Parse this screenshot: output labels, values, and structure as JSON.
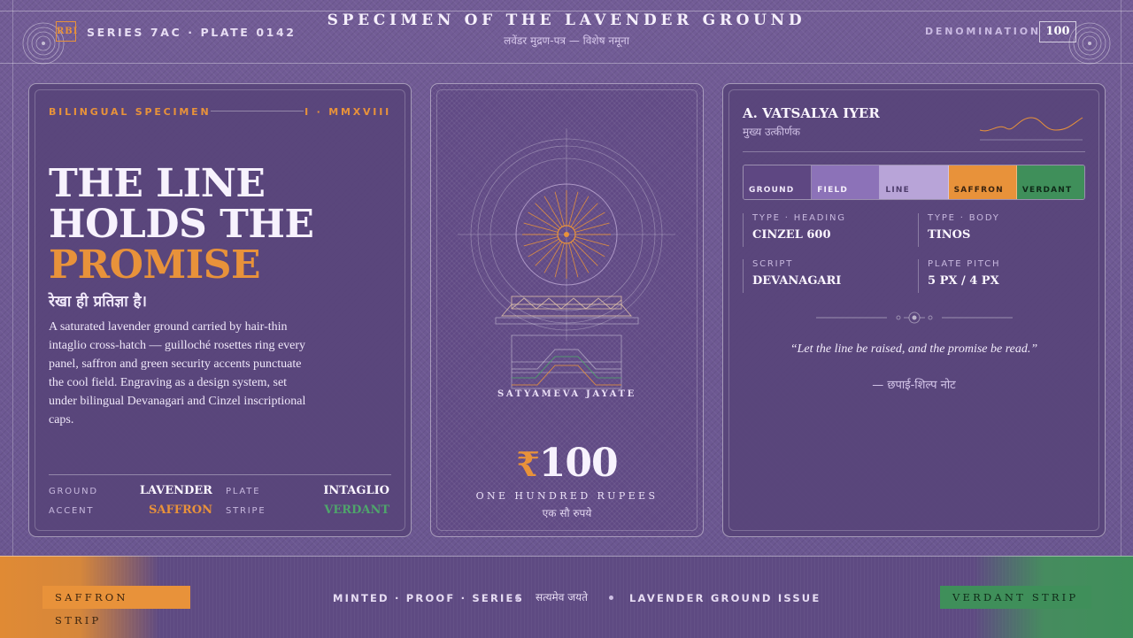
{
  "colors": {
    "ground": "#5e4782",
    "field": "#8c72b8",
    "line": "#b8a4d8",
    "saffron": "#e8923a",
    "verdant": "#3f8f5a"
  },
  "header": {
    "emblem": "RBI",
    "series": "SERIES 7AC · PLATE 0142",
    "title": "SPECIMEN OF THE LAVENDER GROUND",
    "subtitle": "लवेंडर मुद्रण-पत्र — विशेष नमूना",
    "denomination_label": "DENOMINATION",
    "denomination_value": "100"
  },
  "left": {
    "kicker": "BILINGUAL SPECIMEN",
    "kicker_right": "I · MMXVIII",
    "headline_1": "THE LINE",
    "headline_2": "HOLDS THE",
    "headline_3": "PROMISE",
    "hindi": "रेखा ही प्रतिज्ञा है।",
    "body": "A saturated lavender ground carried by hair-thin intaglio cross-hatch — guilloché rosettes ring every panel, saffron and green security accents punctuate the cool field. Engraving as a design system, set under bilingual Devanagari and Cinzel inscriptional caps.",
    "specs": {
      "ground_label": "GROUND",
      "ground_value": "LAVENDER",
      "plate_label": "PLATE",
      "plate_value": "INTAGLIO",
      "accent_label": "ACCENT",
      "accent_value": "SAFFRON",
      "stripe_label": "STRIPE",
      "stripe_value": "VERDANT"
    }
  },
  "middle": {
    "motto": "SATYAMEVA JAYATE",
    "currency": "₹",
    "amount": "100",
    "amount_words": "ONE HUNDRED RUPEES",
    "amount_hindi": "एक सौ रुपये"
  },
  "right": {
    "engraver": "A. VATSALYA IYER",
    "engraver_role": "मुख्य उत्कीर्णक",
    "swatches": [
      "GROUND",
      "FIELD",
      "LINE",
      "SAFFRON",
      "VERDANT"
    ],
    "type": {
      "heading_label": "TYPE · HEADING",
      "heading_value": "CINZEL 600",
      "body_label": "TYPE · BODY",
      "body_value": "TINOS",
      "script_label": "SCRIPT",
      "script_value": "DEVANAGARI",
      "pitch_label": "PLATE PITCH",
      "pitch_value": "5 PX / 4 PX"
    },
    "quote": "“Let the line be raised, and the promise be read.”",
    "quote_by": "— छपाई-शिल्प नोट"
  },
  "footer": {
    "saffron_strip": "SAFFRON STRIP",
    "text_1": "MINTED · PROOF · SERIES",
    "text_hindi": "सत्यमेव जयते",
    "text_2": "LAVENDER GROUND ISSUE",
    "verdant_strip": "VERDANT STRIP"
  }
}
